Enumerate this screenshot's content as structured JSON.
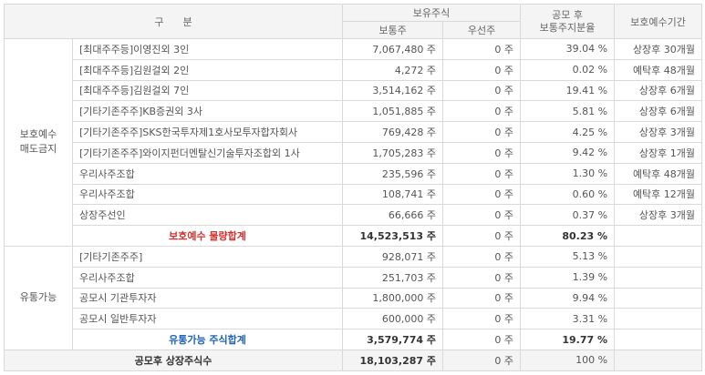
{
  "header": {
    "category": "구      분",
    "holdings": "보유주식",
    "ratio_line1": "공모 후",
    "ratio_line2": "보통주지분율",
    "period": "보호예수기간",
    "common": "보통주",
    "preferred": "우선주"
  },
  "group1": {
    "label_line1": "보호예수",
    "label_line2": "매도금지",
    "rows": [
      {
        "name": "[최대주주등]이영진외 3인",
        "common": "7,067,480 주",
        "preferred": "0 주",
        "ratio": "39.04 %",
        "period": "상장후 30개월"
      },
      {
        "name": "[최대주주등]김원걸외 2인",
        "common": "4,272 주",
        "preferred": "0 주",
        "ratio": "0.02 %",
        "period": "예탁후 48개월"
      },
      {
        "name": "[최대주주등]김원걸외 7인",
        "common": "3,514,162 주",
        "preferred": "0 주",
        "ratio": "19.41 %",
        "period": "상장후 6개월"
      },
      {
        "name": "[기타기존주주]KB증권외 3사",
        "common": "1,051,885 주",
        "preferred": "0 주",
        "ratio": "5.81 %",
        "period": "상장후 6개월"
      },
      {
        "name": "[기타기존주주]SKS한국투자제1호사모투자합자회사",
        "common": "769,428 주",
        "preferred": "0 주",
        "ratio": "4.25 %",
        "period": "상장후 3개월"
      },
      {
        "name": "[기타기존주주]와이지펀더멘탈신기술투자조합외 1사",
        "common": "1,705,283 주",
        "preferred": "0 주",
        "ratio": "9.42 %",
        "period": "상장후 1개월"
      },
      {
        "name": "우리사주조합",
        "common": "235,596 주",
        "preferred": "0 주",
        "ratio": "1.30 %",
        "period": "예탁후 48개월"
      },
      {
        "name": "우리사주조합",
        "common": "108,741 주",
        "preferred": "0 주",
        "ratio": "0.60 %",
        "period": "예탁후 12개월"
      },
      {
        "name": "상장주선인",
        "common": "66,666 주",
        "preferred": "0 주",
        "ratio": "0.37 %",
        "period": "상장후 3개월"
      }
    ],
    "subtotal": {
      "label": "보호예수 물량합계",
      "common": "14,523,513 주",
      "preferred": "0 주",
      "ratio": "80.23 %"
    }
  },
  "group2": {
    "label": "유통가능",
    "rows": [
      {
        "name": "[기타기존주주]",
        "common": "928,071 주",
        "preferred": "0 주",
        "ratio": "5.13 %"
      },
      {
        "name": "우리사주조합",
        "common": "251,703 주",
        "preferred": "0 주",
        "ratio": "1.39 %"
      },
      {
        "name": "공모시 기관투자자",
        "common": "1,800,000 주",
        "preferred": "0 주",
        "ratio": "9.94 %"
      },
      {
        "name": "공모시 일반투자자",
        "common": "600,000 주",
        "preferred": "0 주",
        "ratio": "3.31 %"
      }
    ],
    "subtotal": {
      "label": "유통가능 주식합계",
      "common": "3,579,774 주",
      "preferred": "0 주",
      "ratio": "19.77 %"
    }
  },
  "total": {
    "label": "공모후 상장주식수",
    "common": "18,103,287 주",
    "preferred": "0 주",
    "ratio": "100 %"
  },
  "colors": {
    "header_bg": "#f4f4f4",
    "border": "#d9d9d9",
    "red_total": "#d0312d",
    "blue_total": "#1f63b5"
  }
}
